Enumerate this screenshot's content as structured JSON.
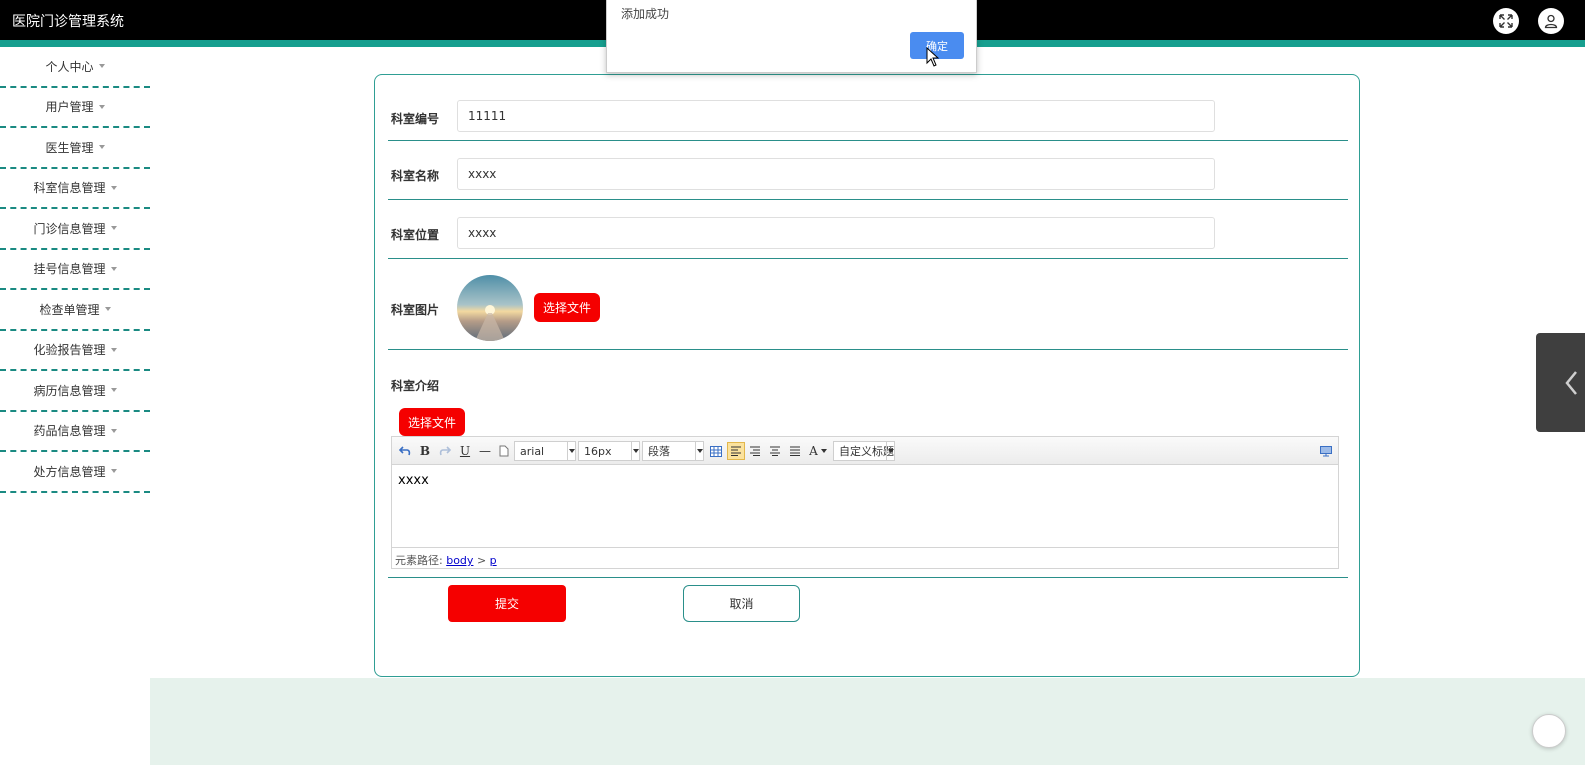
{
  "app": {
    "title": "医院门诊管理系统"
  },
  "colors": {
    "accent": "#179f8f",
    "red": "#f50000",
    "ok_blue": "#4a8cf0"
  },
  "icons": {
    "fullscreen": "expand-arrows-icon",
    "user": "user-icon",
    "side_tab": "chevron-left-icon"
  },
  "sidebar": {
    "items": [
      {
        "label": "个人中心"
      },
      {
        "label": "用户管理"
      },
      {
        "label": "医生管理"
      },
      {
        "label": "科室信息管理"
      },
      {
        "label": "门诊信息管理"
      },
      {
        "label": "挂号信息管理"
      },
      {
        "label": "检查单管理"
      },
      {
        "label": "化验报告管理"
      },
      {
        "label": "病历信息管理"
      },
      {
        "label": "药品信息管理"
      },
      {
        "label": "处方信息管理"
      }
    ]
  },
  "form": {
    "dept_no": {
      "label": "科室编号",
      "value": "11111"
    },
    "dept_name": {
      "label": "科室名称",
      "value": "xxxx"
    },
    "dept_location": {
      "label": "科室位置",
      "value": "xxxx"
    },
    "dept_image": {
      "label": "科室图片",
      "button": "选择文件"
    },
    "dept_intro": {
      "label": "科室介绍",
      "button": "选择文件"
    },
    "submit": "提交",
    "cancel": "取消"
  },
  "editor": {
    "font": "arial",
    "size": "16px",
    "paragraph": "段落",
    "custom_title": "自定义标题",
    "content": "xxxx",
    "path_label": "元素路径:",
    "path_body": "body",
    "path_sep": ">",
    "path_p": "p",
    "buttons": {
      "bold": "B",
      "underline": "U",
      "hr": "—",
      "font_color": "A"
    }
  },
  "alert": {
    "message": "添加成功",
    "ok": "确定"
  }
}
